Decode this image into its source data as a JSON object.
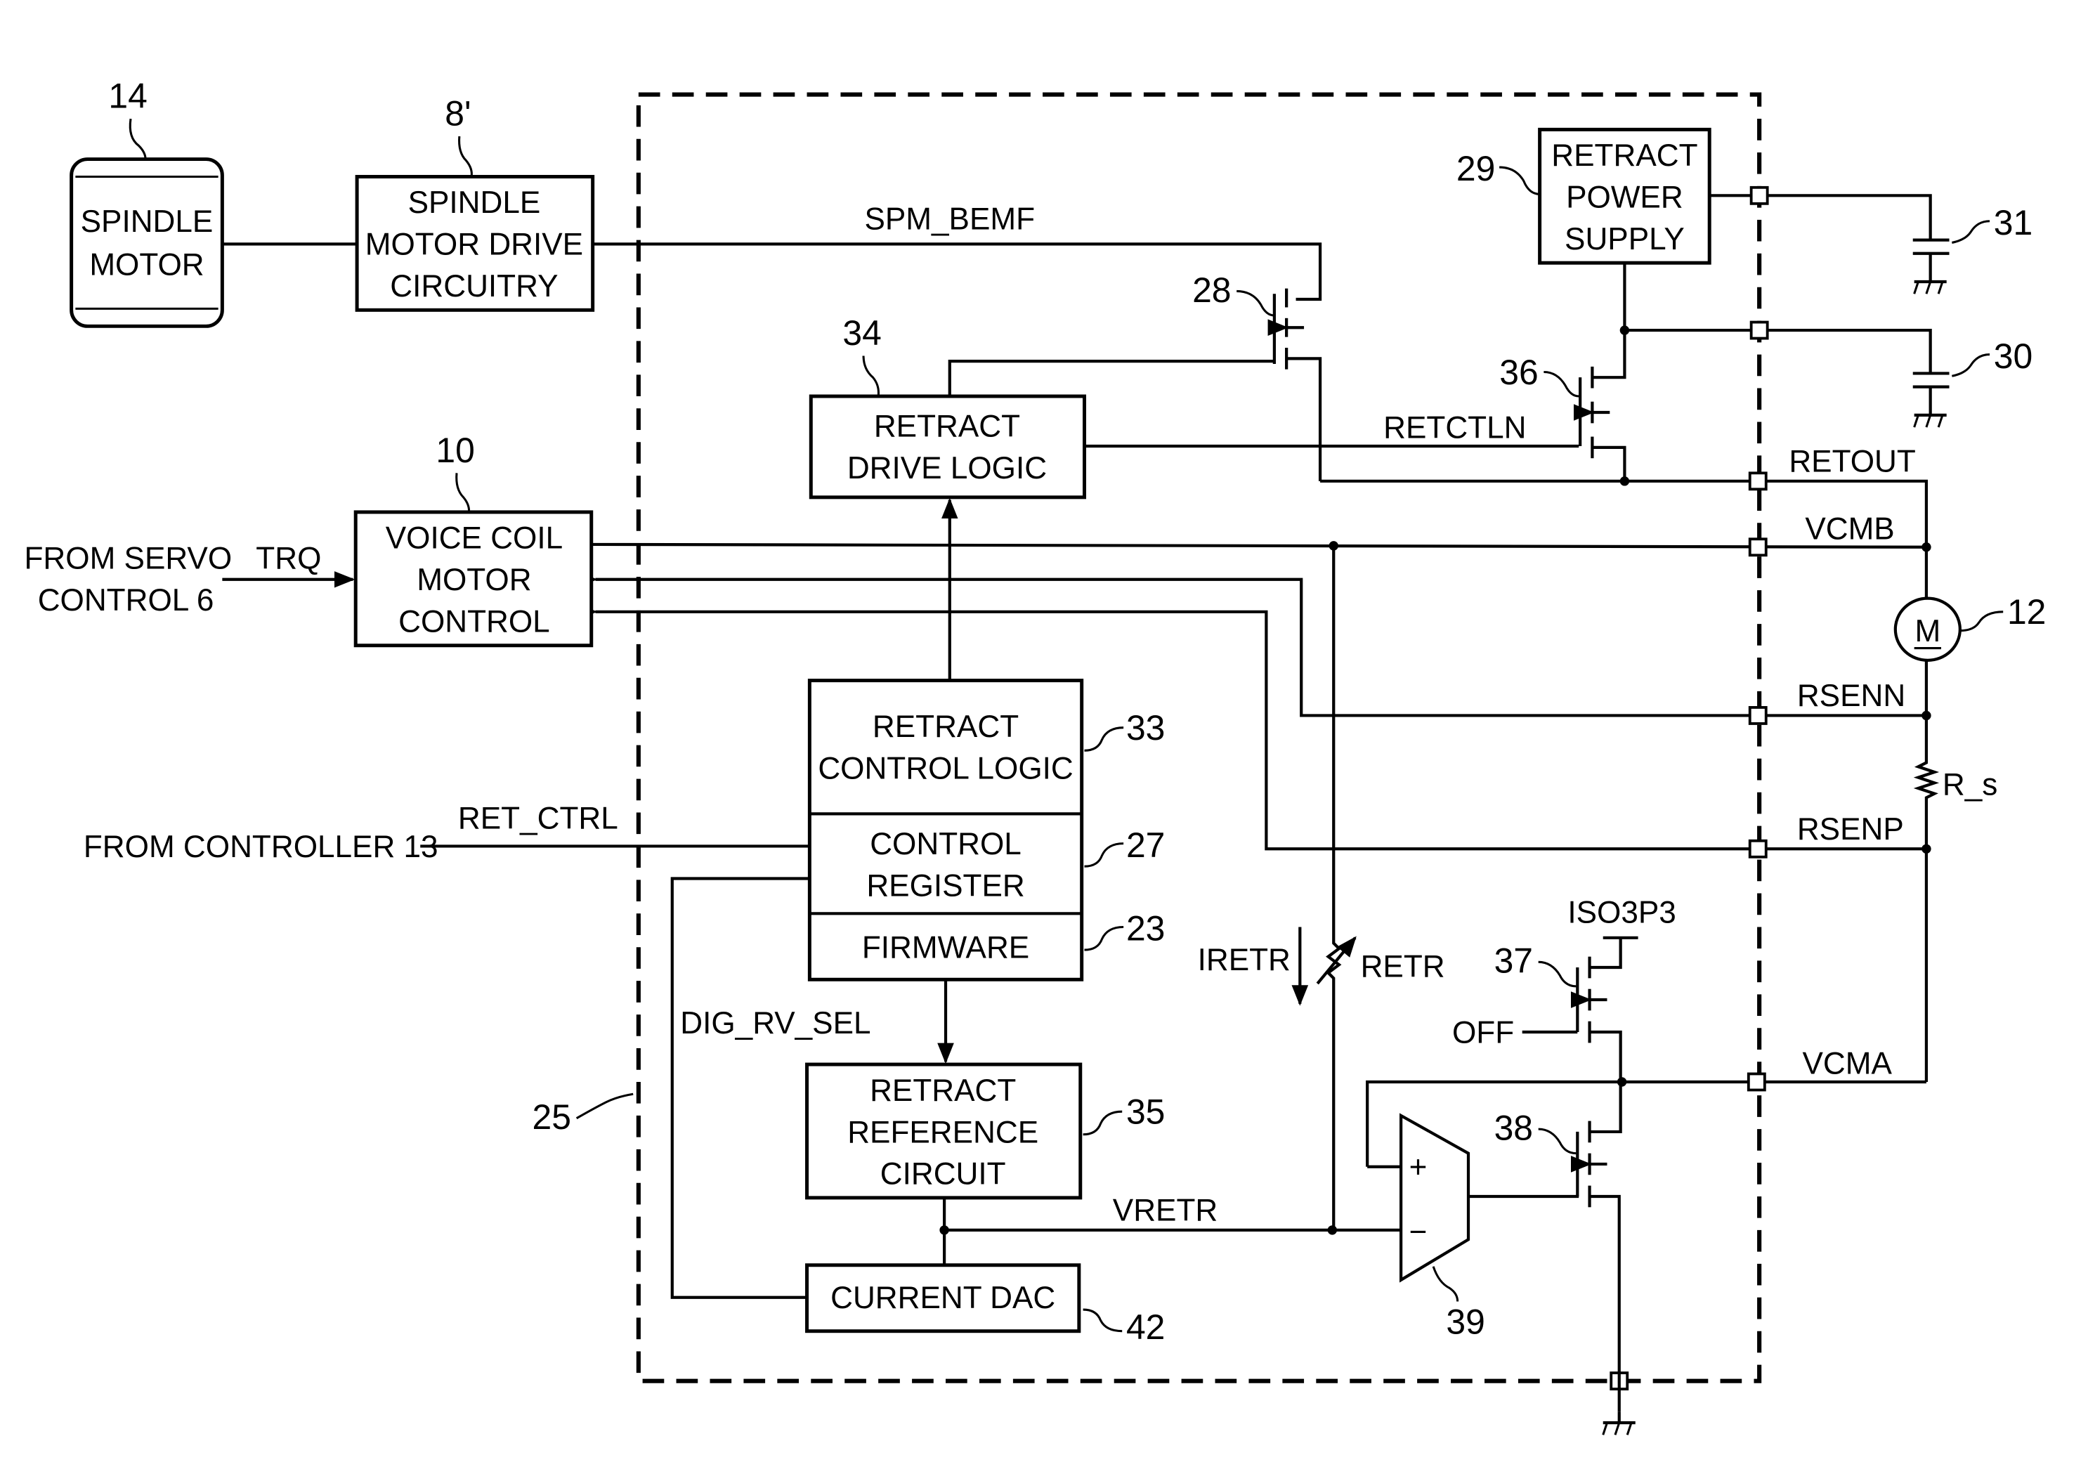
{
  "figure": {
    "boundary_ref": "25",
    "blocks": {
      "spindle_motor": {
        "ref": "14",
        "lines": [
          "SPINDLE",
          "MOTOR"
        ]
      },
      "spindle_drive": {
        "ref": "8'",
        "lines": [
          "SPINDLE",
          "MOTOR DRIVE",
          "CIRCUITRY"
        ]
      },
      "vcm_control": {
        "ref": "10",
        "lines": [
          "VOICE COIL",
          "MOTOR",
          "CONTROL"
        ]
      },
      "retract_power_supply": {
        "ref": "29",
        "lines": [
          "RETRACT",
          "POWER",
          "SUPPLY"
        ]
      },
      "retract_drive_logic": {
        "ref": "34",
        "lines": [
          "RETRACT",
          "DRIVE LOGIC"
        ]
      },
      "retract_control_logic": {
        "ref": "33",
        "lines": [
          "RETRACT",
          "CONTROL LOGIC"
        ]
      },
      "control_register": {
        "ref": "27",
        "lines": [
          "CONTROL",
          "REGISTER"
        ]
      },
      "firmware": {
        "ref": "23",
        "lines": [
          "FIRMWARE"
        ]
      },
      "retract_reference": {
        "ref": "35",
        "lines": [
          "RETRACT",
          "REFERENCE",
          "CIRCUIT"
        ]
      },
      "current_dac": {
        "ref": "42",
        "lines": [
          "CURRENT DAC"
        ]
      }
    },
    "components": {
      "transistor_28": "28",
      "transistor_36": "36",
      "transistor_37": "37",
      "transistor_38": "38",
      "amplifier_39": "39",
      "capacitor_31": "31",
      "capacitor_30": "30",
      "motor_12": {
        "ref": "12",
        "symbol": "M"
      },
      "sense_resistor": "R_s",
      "variable_resistor": "RETR"
    },
    "signals": {
      "spm_bemf": "SPM_BEMF",
      "retctln": "RETCTLN",
      "retout": "RETOUT",
      "vcmb": "VCMB",
      "rsenn": "RSENN",
      "rsenp": "RSENP",
      "vcma": "VCMA",
      "trq": "TRQ",
      "ret_ctrl": "RET_CTRL",
      "dig_rv_sel": "DIG_RV_SEL",
      "vretr": "VRETR",
      "iretr": "IRETR",
      "iso3p3": "ISO3P3",
      "off": "OFF"
    },
    "external_inputs": {
      "servo": [
        "FROM SERVO",
        "CONTROL 6"
      ],
      "controller": "FROM CONTROLLER 13"
    },
    "amp_inputs": {
      "plus": "+",
      "minus": "−"
    }
  }
}
